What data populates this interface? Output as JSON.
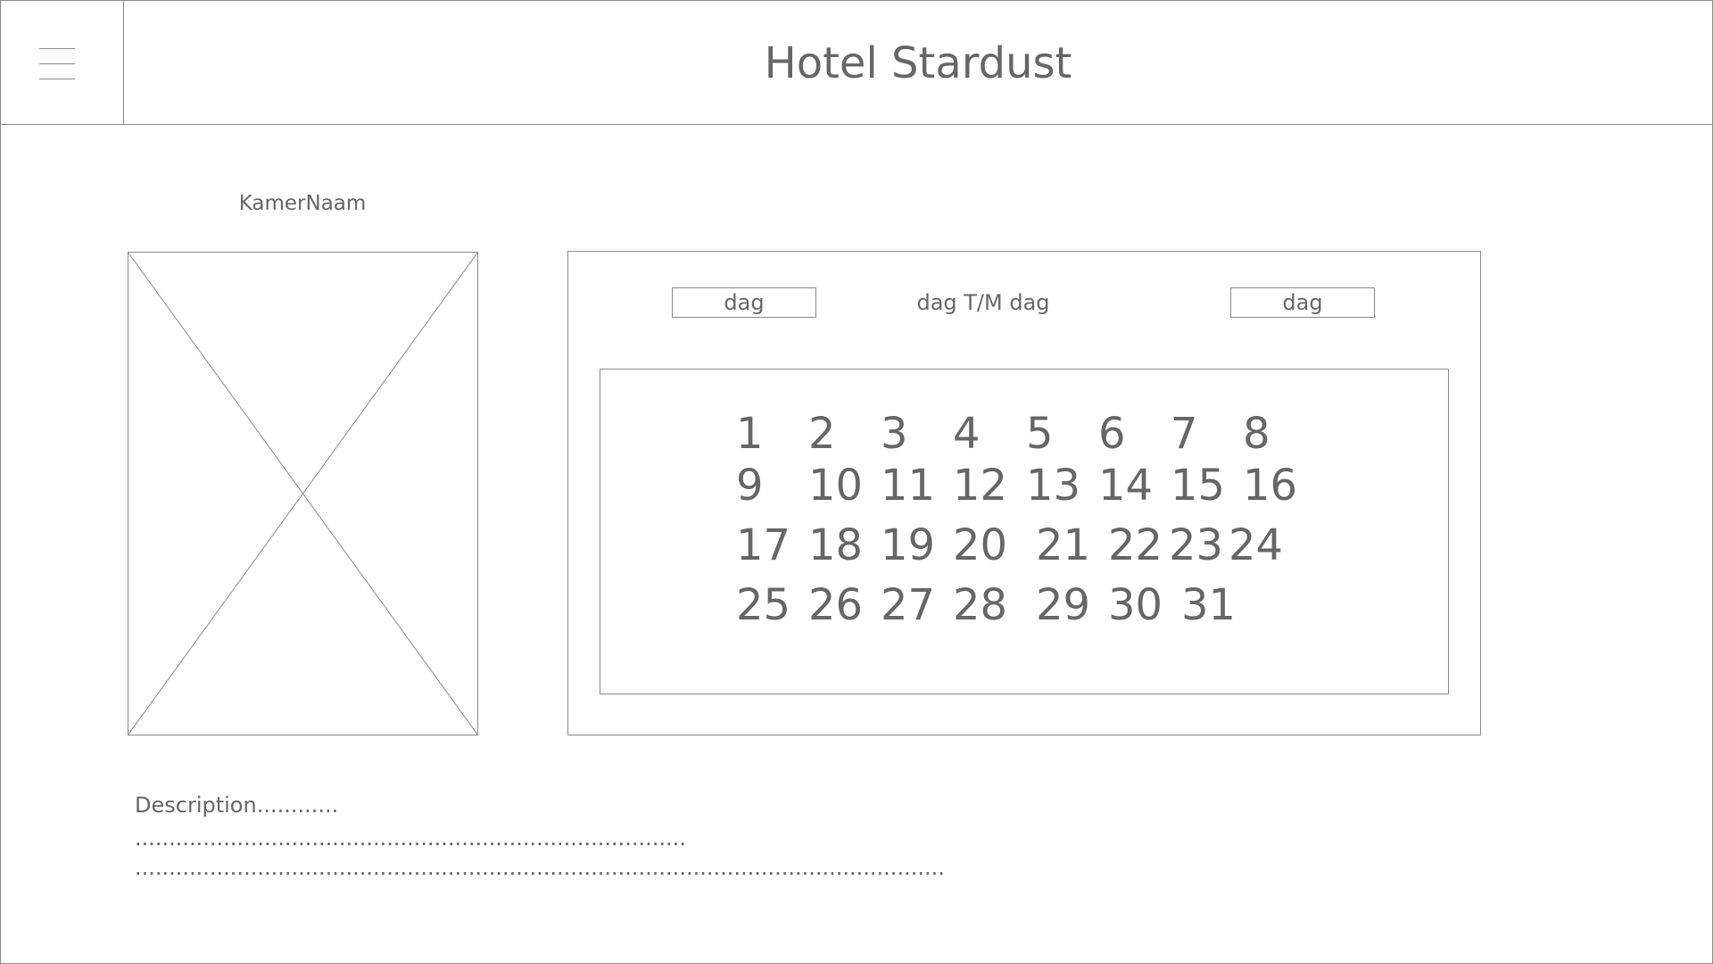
{
  "header": {
    "title": "Hotel Stardust",
    "menu_icon": "hamburger-menu-icon"
  },
  "room": {
    "name": "KamerNaam",
    "image_icon": "image-placeholder-icon"
  },
  "booking": {
    "from_value": "dag",
    "range_label": "dag T/M dag",
    "to_value": "dag"
  },
  "calendar": {
    "days": [
      "1",
      "2",
      "3",
      "4",
      "5",
      "6",
      "7",
      "8",
      "9",
      "10",
      "11",
      "12",
      "13",
      "14",
      "15",
      "16",
      "17",
      "18",
      "19",
      "20",
      "21",
      "22",
      "23",
      "24",
      "25",
      "26",
      "27",
      "28",
      "29",
      "30",
      "31"
    ]
  },
  "description": {
    "label": "Description............",
    "line1": "............................................................................................................",
    "line2": "...................................................................................................................................................................."
  },
  "colors": {
    "line": "#8a8a8a",
    "text": "#666666",
    "background": "#ffffff"
  }
}
